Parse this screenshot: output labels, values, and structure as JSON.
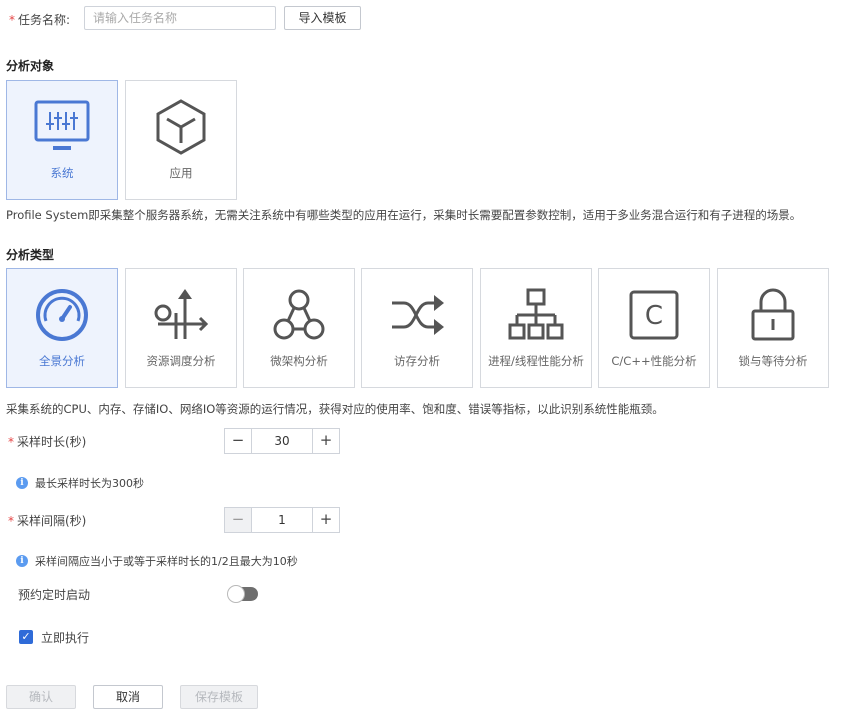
{
  "task": {
    "label": "任务名称:",
    "placeholder": "请输入任务名称",
    "import_label": "导入模板"
  },
  "target": {
    "title": "分析对象",
    "cards": [
      {
        "label": "系统",
        "icon": "monitor-sliders-icon",
        "selected": true
      },
      {
        "label": "应用",
        "icon": "hexagon-cube-icon",
        "selected": false
      }
    ],
    "description": "Profile System即采集整个服务器系统，无需关注系统中有哪些类型的应用在运行，采集时长需要配置参数控制，适用于多业务混合运行和有子进程的场景。"
  },
  "type": {
    "title": "分析类型",
    "cards": [
      {
        "label": "全景分析",
        "icon": "gauge-icon",
        "selected": true
      },
      {
        "label": "资源调度分析",
        "icon": "resource-schedule-icon",
        "selected": false
      },
      {
        "label": "微架构分析",
        "icon": "microarch-nodes-icon",
        "selected": false
      },
      {
        "label": "访存分析",
        "icon": "shuffle-arrows-icon",
        "selected": false
      },
      {
        "label": "进程/线程性能分析",
        "icon": "process-tree-icon",
        "selected": false
      },
      {
        "label": "C/C++性能分析",
        "icon": "c-letter-icon",
        "selected": false
      },
      {
        "label": "锁与等待分析",
        "icon": "lock-icon",
        "selected": false
      }
    ],
    "description": "采集系统的CPU、内存、存储IO、网络IO等资源的运行情况，获得对应的使用率、饱和度、错误等指标，以此识别系统性能瓶颈。"
  },
  "duration": {
    "label": "采样时长(秒)",
    "value": "30",
    "minus": "−",
    "plus": "+",
    "hint": "最长采样时长为300秒"
  },
  "interval": {
    "label": "采样间隔(秒)",
    "value": "1",
    "minus": "−",
    "plus": "+",
    "hint": "采样间隔应当小于或等于采样时长的1/2且最大为10秒"
  },
  "schedule": {
    "label": "预约定时启动",
    "enabled": false
  },
  "immediate": {
    "label": "立即执行",
    "checked": true
  },
  "actions": {
    "confirm": "确认",
    "cancel": "取消",
    "save_template": "保存模板"
  },
  "colors": {
    "accent": "#4a78d3",
    "required": "#e54545",
    "selected_bg": "#eef3fd",
    "info": "#5b9bf0",
    "checkbox": "#2f6bd8"
  }
}
